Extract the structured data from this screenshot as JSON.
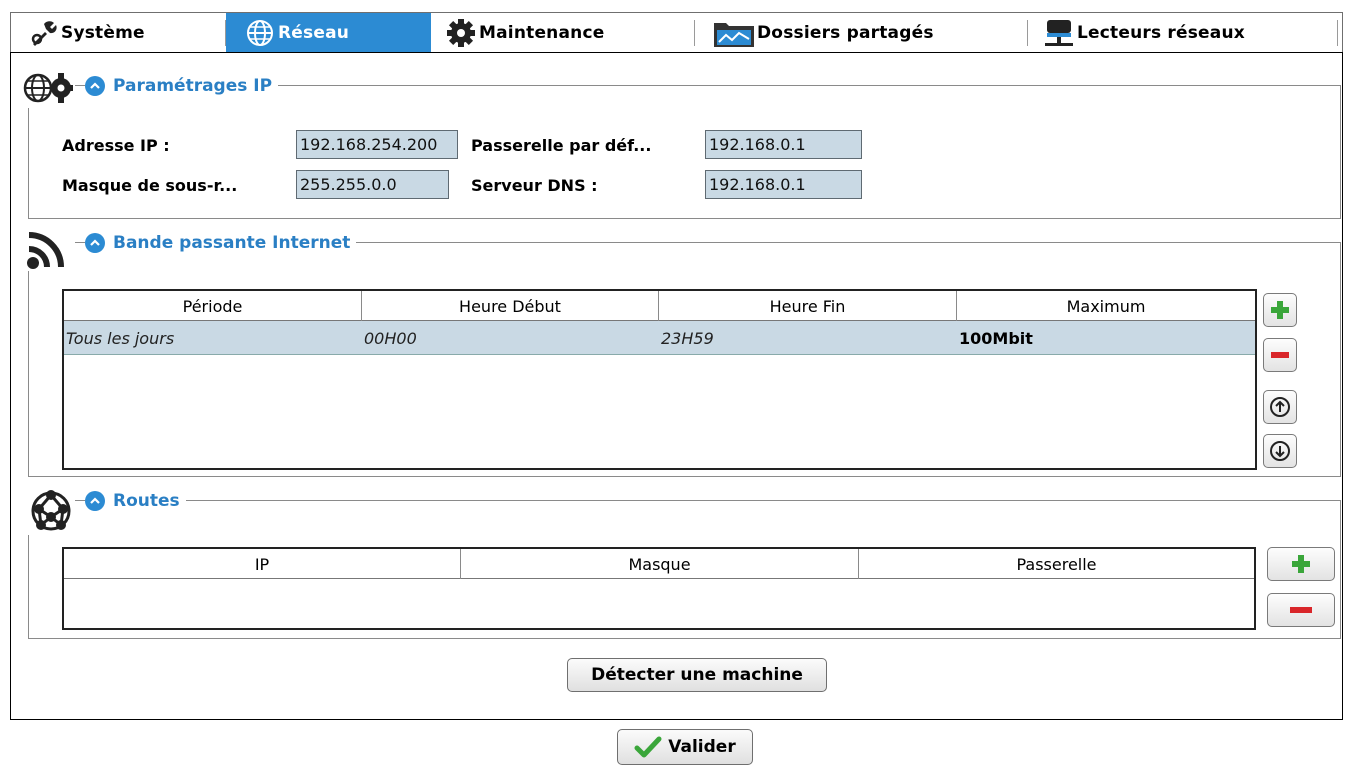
{
  "tabs": [
    {
      "label": "Système",
      "icon": "tools-icon"
    },
    {
      "label": "Réseau",
      "icon": "globe-icon"
    },
    {
      "label": "Maintenance",
      "icon": "gear-icon"
    },
    {
      "label": "Dossiers partagés",
      "icon": "shared-folder-icon"
    },
    {
      "label": "Lecteurs réseaux",
      "icon": "network-drive-icon"
    }
  ],
  "active_tab": "Réseau",
  "ip_settings": {
    "title": "Paramétrages IP",
    "ip_label": "Adresse IP :",
    "ip_value": "192.168.254.200",
    "gateway_label": "Passerelle par déf...",
    "gateway_value": "192.168.0.1",
    "mask_label": "Masque de sous-r...",
    "mask_value": "255.255.0.0",
    "dns_label": "Serveur DNS :",
    "dns_value": "192.168.0.1"
  },
  "bandwidth": {
    "title": "Bande passante Internet",
    "columns": [
      "Période",
      "Heure Début",
      "Heure Fin",
      "Maximum"
    ],
    "rows": [
      {
        "period": "Tous les jours",
        "start": "00H00",
        "end": "23H59",
        "max": "100Mbit"
      }
    ]
  },
  "routes": {
    "title": "Routes",
    "columns": [
      "IP",
      "Masque",
      "Passerelle"
    ],
    "rows": []
  },
  "detect_button": "Détecter une machine",
  "validate_button": "Valider",
  "colors": {
    "accent": "#2c8bd3",
    "field_bg": "#c9d9e4",
    "add_green": "#3aa63a",
    "remove_red": "#d9262a"
  }
}
